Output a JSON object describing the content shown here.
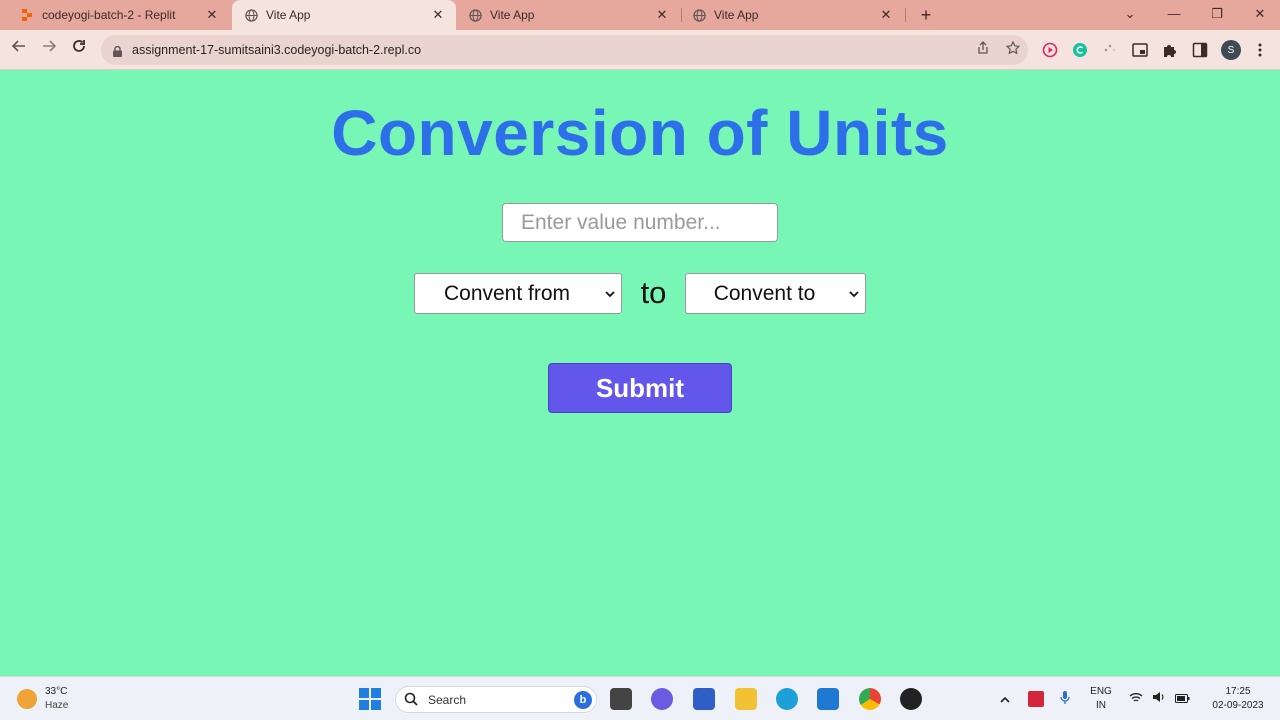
{
  "tabs": [
    {
      "label": "codeyogi-batch-2 - Replit",
      "icon": "replit-icon",
      "active": false
    },
    {
      "label": "Vite App",
      "icon": "globe-icon",
      "active": true
    },
    {
      "label": "Vite App",
      "icon": "globe-icon",
      "active": false
    },
    {
      "label": "Vite App",
      "icon": "globe-icon",
      "active": false
    }
  ],
  "tab_close_glyph": "✕",
  "new_tab_glyph": "+",
  "window_controls": {
    "dropdown": "⌄",
    "minimize": "—",
    "restore": "❐",
    "close": "✕"
  },
  "address_bar": {
    "url": "assignment-17-sumitsaini3.codeyogi-batch-2.repl.co"
  },
  "extensions": [
    {
      "name": "record-extension-icon",
      "color": "#e0245e"
    },
    {
      "name": "grammarly-extension-icon",
      "color": "#15c39a"
    },
    {
      "name": "loading-extension-icon",
      "color": "#9a9a9a"
    },
    {
      "name": "picture-in-picture-icon",
      "color": "#3a2a28"
    },
    {
      "name": "extensions-puzzle-icon",
      "color": "#3a2a28"
    },
    {
      "name": "side-panel-icon",
      "color": "#3a2a28"
    }
  ],
  "profile": {
    "initial": "S"
  },
  "page": {
    "title": "Conversion of Units",
    "input_placeholder": "Enter value number...",
    "from_select": "Convent from",
    "to_label": "to",
    "to_select": "Convent to",
    "submit_label": "Submit"
  },
  "colors": {
    "page_background": "#78f6b6",
    "title": "#2d6fe8",
    "submit_button": "#6257ea",
    "tab_strip": "#e6a89c"
  },
  "taskbar": {
    "weather": {
      "temp": "33°C",
      "desc": "Haze"
    },
    "search_label": "Search",
    "bing_glyph": "b",
    "language": {
      "lang": "ENG",
      "region": "IN"
    },
    "clock": {
      "time": "17:25",
      "date": "02-09-2023"
    }
  }
}
